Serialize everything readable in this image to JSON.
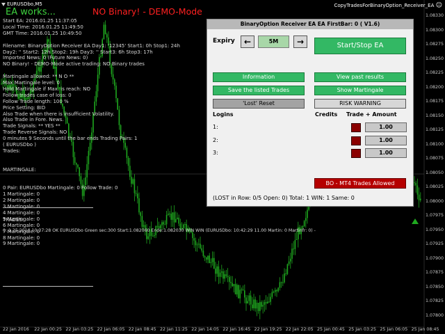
{
  "window": {
    "symbol_label": "EURUSDbo,M5",
    "status_text": "EA works...",
    "demo_mode_text": "NO Binary! - DEMO-Mode",
    "title_right": "CopyTradesForBinaryOption_Receiver_EA"
  },
  "info_lines": [
    "Start EA:        2016.01.25  11:37:05",
    "Local Time:     2016.01.25  11:49:50",
    "GMT Time:       2016.01.25  10:49:50",
    "",
    "Filename: BinaryOption Receiver EA      Day1: '12345' Start1: 0h  Stop1: 24h",
    "Day2: '' Start2: 12h  Stop2: 19h  Day3: '' Start3: 6h  Stop3: 17h",
    "Imported News: 0 (Future News: 0)",
    "NO Binary! - DEMO-Mode   active trading:   NO Binary trades",
    "",
    "Martingale allowed:  **  N O  **",
    "Max Martingale level: 0",
    "Hold Martingale if Max. is reach:  NO",
    "Follow trades case of loss: 0",
    "Follow Trade length: 100 %",
    "Price Setting: BID",
    "Also Trade when there is insufficient Volatility.",
    "Also Trade in Fore. News.",
    "Trade Signals:    **  YES  **",
    "Trade Reverse Signals:   NO",
    "0 minutes 9 Seconds until the bar ends    Trading Pairs: 1",
    "  ( EURUSDbo )",
    "Trades:",
    "",
    "",
    "MARTINGALE:",
    "",
    "",
    "0  Pair: EURUSDbo   Martingale: 0   Follow Trade: 0",
    "1  Martingale: 0",
    "2  Martingale: 0",
    "3  Martingale: 0",
    "4  Martingale: 0",
    "5  Martingale: 0",
    "6  Martingale: 0",
    "7  Martingale: 0",
    "8  Martingale: 0",
    "9  Martingale: 0"
  ],
  "trades_label": "TRADES:",
  "trade_record": "0: 1.25.2016  10:37:28 OK EURUSDbo   Green   sec:300  Start:1.082060  Ende:1.082030  WIN  WIN  (EURUSDbo: 10:42:29  11.00   Martin: 0   Martinfr: 0)  -",
  "panel": {
    "header": "BinaryOption Receiver EA EA  FirstBar: 0  ( V1.6)",
    "expiry_label": "Expiry",
    "expiry_left": "←",
    "expiry_value": "5M",
    "expiry_right": "→",
    "start_stop": "Start/Stop EA",
    "buttons": {
      "information": "Information",
      "view_results": "View past results",
      "save_trades": "Save the listed Trades",
      "show_martingale": "Show Martingale",
      "lost_reset": "'Lost' Reset",
      "risk_warning": "RISK WARNING"
    },
    "logins_label": "Logins",
    "credits_label": "Credits",
    "trade_amount_label": "Trade + Amount",
    "logins": [
      {
        "num": "1:",
        "amount": "1.00"
      },
      {
        "num": "2:",
        "amount": "1.00"
      },
      {
        "num": "3:",
        "amount": "1.00"
      }
    ],
    "mt4_button": "BO - MT4 Trades Allowed",
    "status_line": "(LOST in Row: 0/5  Open: 0) Total: 1 WIN: 1 Same: 0"
  },
  "price_axis": [
    "1.08330",
    "1.08300",
    "1.08275",
    "1.08250",
    "1.08225",
    "1.08200",
    "1.08175",
    "1.08150",
    "1.08125",
    "1.08100",
    "1.08075",
    "1.08050",
    "1.08025",
    "1.08000",
    "1.07975",
    "1.07950",
    "1.07925",
    "1.07900",
    "1.07875",
    "1.07850",
    "1.07825",
    "1.07800"
  ],
  "time_axis": [
    "22 Jan 2016",
    "22 Jan 00:25",
    "22 Jan 03:25",
    "22 Jan 06:05",
    "22 Jan 08:45",
    "22 Jan 11:25",
    "22 Jan 14:05",
    "22 Jan 16:45",
    "22 Jan 19:25",
    "22 Jan 22:05",
    "25 Jan 00:45",
    "25 Jan 03:25",
    "25 Jan 06:05",
    "25 Jan 08:45"
  ],
  "colors": {
    "candle": "#1fa81f",
    "background": "#000000",
    "text": "#ffffff"
  }
}
